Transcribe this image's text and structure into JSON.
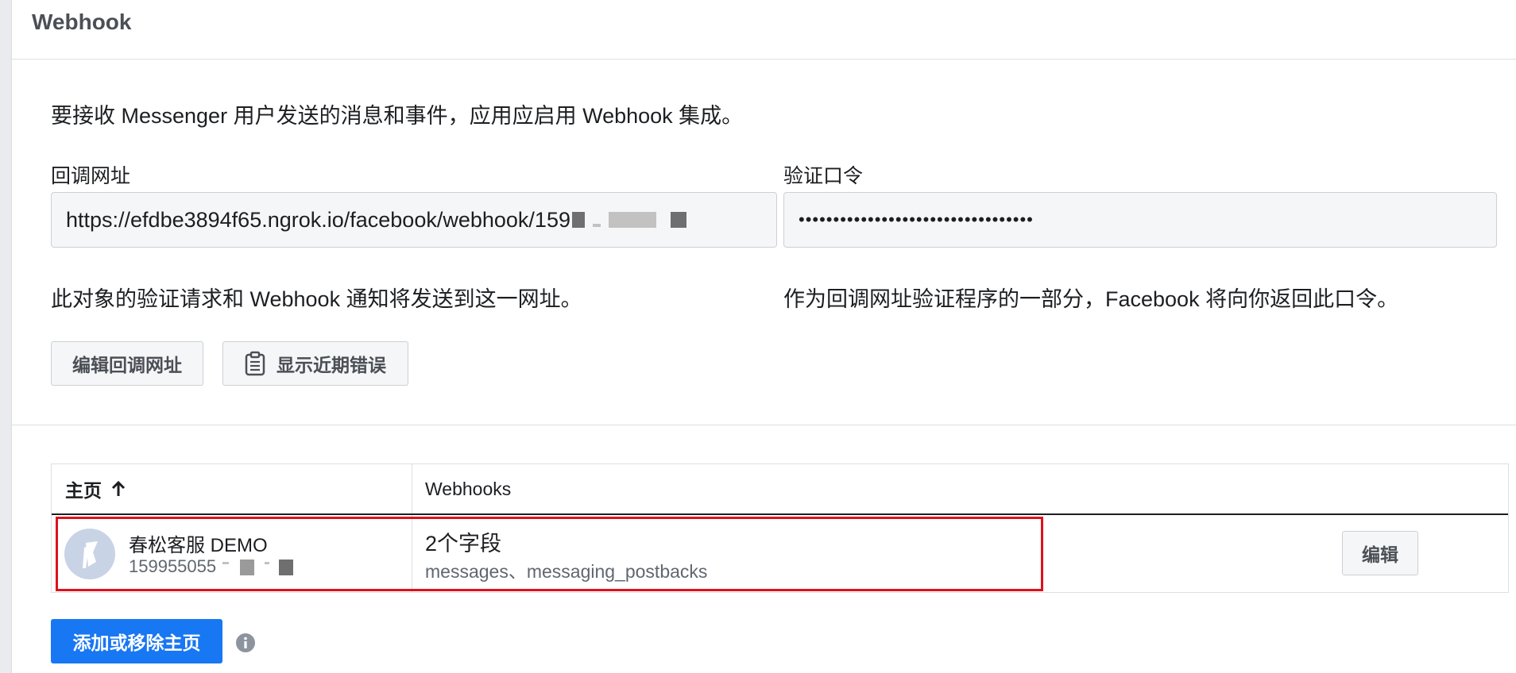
{
  "panel": {
    "title": "Webhook"
  },
  "intro": "要接收 Messenger 用户发送的消息和事件，应用应启用 Webhook 集成。",
  "callback": {
    "label": "回调网址",
    "value_prefix": "https://efdbe3894f65.ngrok.io/facebook/webhook/159",
    "help": "此对象的验证请求和 Webhook 通知将发送到这一网址。"
  },
  "verify": {
    "label": "验证口令",
    "value": "••••••••••••••••••••••••••••••••••",
    "help": "作为回调网址验证程序的一部分，Facebook 将向你返回此口令。"
  },
  "buttons": {
    "edit_callback": "编辑回调网址",
    "show_errors": "显示近期错误",
    "add_remove": "添加或移除主页",
    "edit": "编辑"
  },
  "table": {
    "headers": {
      "page": "主页",
      "webhooks": "Webhooks"
    },
    "rows": [
      {
        "page_name": "春松客服 DEMO",
        "page_id_prefix": "159955055",
        "fields_count": "2个字段",
        "fields_list": "messages、messaging_postbacks"
      }
    ]
  },
  "icons": {
    "sort": "arrow-up-icon",
    "clipboard": "clipboard-icon",
    "info": "info-icon",
    "avatar": "page-flag-avatar"
  },
  "colors": {
    "primary": "#1877f2",
    "highlight": "#e0101c"
  }
}
